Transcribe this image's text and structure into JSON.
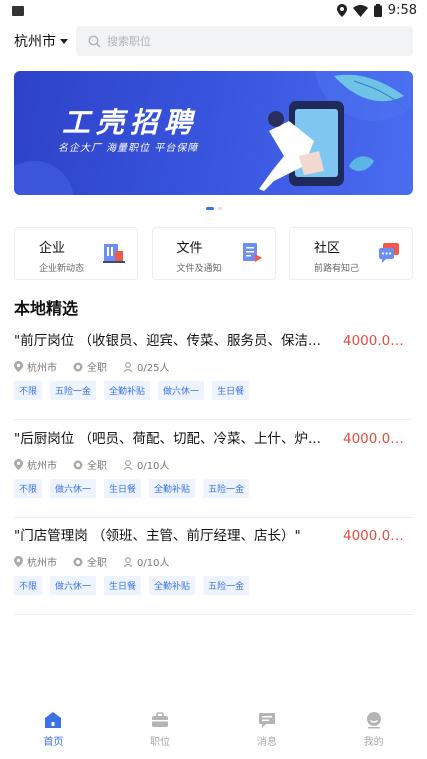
{
  "status_bar": {
    "time": "9:58"
  },
  "header": {
    "city": "杭州市",
    "search_placeholder": "搜索职位"
  },
  "banner": {
    "title": "工壳招聘",
    "subtitle": "名企大厂 海量职位 平台保障"
  },
  "quick_links": [
    {
      "title": "企业",
      "subtitle": "企业新动态",
      "icon": "company-icon"
    },
    {
      "title": "文件",
      "subtitle": "文件及通知",
      "icon": "document-icon"
    },
    {
      "title": "社区",
      "subtitle": "前路有知己",
      "icon": "chat-icon"
    }
  ],
  "section_title": "本地精选",
  "jobs": [
    {
      "title": "\"前厅岗位 （收银员、迎宾、传菜、服务员、保洁...",
      "salary": "4000.0元...",
      "city": "杭州市",
      "type": "全职",
      "count": "0/25人",
      "tags": [
        "不限",
        "五险一金",
        "全勤补贴",
        "做六休一",
        "生日餐"
      ]
    },
    {
      "title": "\"后厨岗位 （吧员、荷配、切配、冷菜、上什、炉...",
      "salary": "4000.0元...",
      "city": "杭州市",
      "type": "全职",
      "count": "0/10人",
      "tags": [
        "不限",
        "做六休一",
        "生日餐",
        "全勤补贴",
        "五险一金"
      ]
    },
    {
      "title": "\"门店管理岗 （领班、主管、前厅经理、店长）\"",
      "salary": "4000.0元...",
      "city": "杭州市",
      "type": "全职",
      "count": "0/10人",
      "tags": [
        "不限",
        "做六休一",
        "生日餐",
        "全勤补贴",
        "五险一金"
      ]
    }
  ],
  "tabbar": [
    {
      "label": "首页",
      "icon": "home-icon",
      "active": true
    },
    {
      "label": "职位",
      "icon": "briefcase-icon",
      "active": false
    },
    {
      "label": "消息",
      "icon": "message-icon",
      "active": false
    },
    {
      "label": "我的",
      "icon": "profile-icon",
      "active": false
    }
  ],
  "colors": {
    "accent": "#3b73e6",
    "salary": "#e84a3d",
    "banner": "#3450d8",
    "tag_bg": "#edf3ff"
  }
}
